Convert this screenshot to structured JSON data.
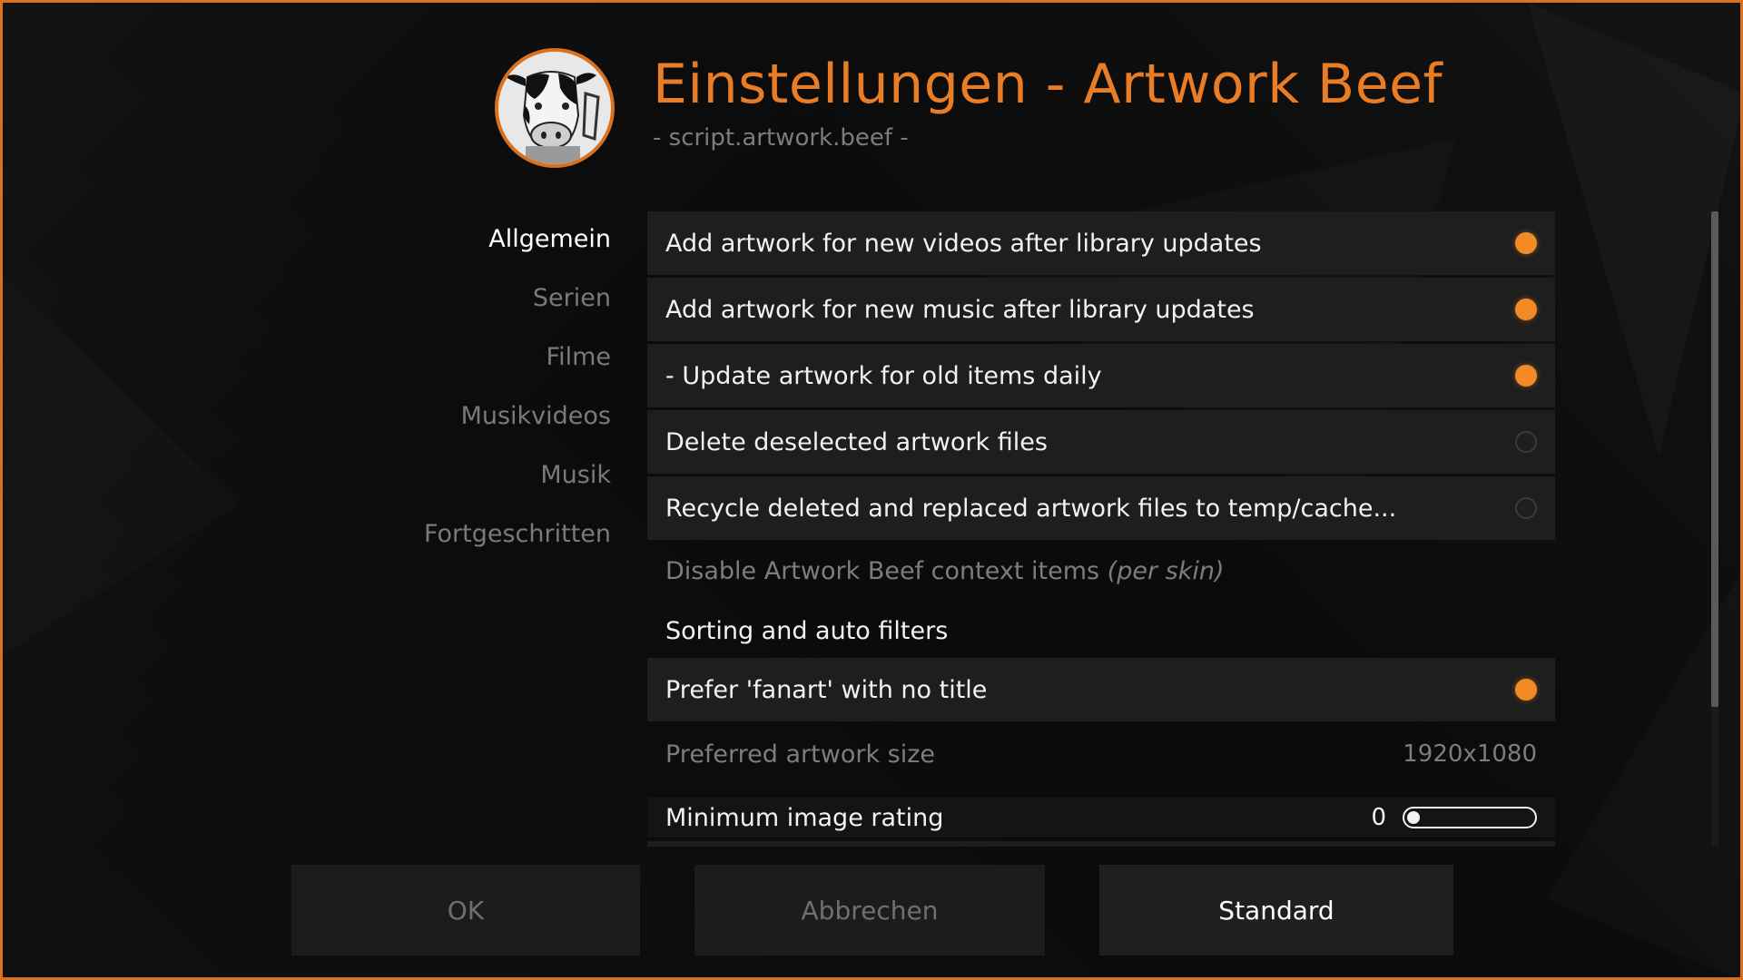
{
  "header": {
    "title": "Einstellungen - Artwork Beef",
    "subtitle": "- script.artwork.beef -",
    "logo_icon": "cow-logo-icon"
  },
  "categories": [
    {
      "label": "Allgemein",
      "active": true
    },
    {
      "label": "Serien",
      "active": false
    },
    {
      "label": "Filme",
      "active": false
    },
    {
      "label": "Musikvideos",
      "active": false
    },
    {
      "label": "Musik",
      "active": false
    },
    {
      "label": "Fortgeschritten",
      "active": false
    }
  ],
  "settings": [
    {
      "label": "Add artwork for new videos after library updates",
      "type": "toggle",
      "state": "on"
    },
    {
      "label": "Add artwork for new music after library updates",
      "type": "toggle",
      "state": "on"
    },
    {
      "label": "- Update artwork for old items daily",
      "type": "toggle",
      "state": "on"
    },
    {
      "label": "Delete deselected artwork files",
      "type": "toggle",
      "state": "off"
    },
    {
      "label": "Recycle deleted and replaced artwork files to temp/cache...",
      "type": "toggle",
      "state": "off"
    },
    {
      "label": "Disable Artwork Beef context items",
      "label_suffix": "(per skin)",
      "type": "action"
    },
    {
      "label": "Sorting and auto filters",
      "type": "category"
    },
    {
      "label": "Prefer 'fanart' with no title",
      "type": "toggle",
      "state": "on"
    },
    {
      "label": "Preferred artwork size",
      "type": "value",
      "value": "1920x1080"
    },
    {
      "label": "Minimum image rating",
      "type": "slider",
      "value": "0",
      "fill": 0
    }
  ],
  "buttons": {
    "ok": "OK",
    "cancel": "Abbrechen",
    "default": "Standard"
  },
  "colors": {
    "accent": "#e87d26",
    "toggle_on": "#f28a26",
    "border": "#d9711f"
  },
  "scroll": {
    "position": 0,
    "visible_fraction": 0.78
  }
}
